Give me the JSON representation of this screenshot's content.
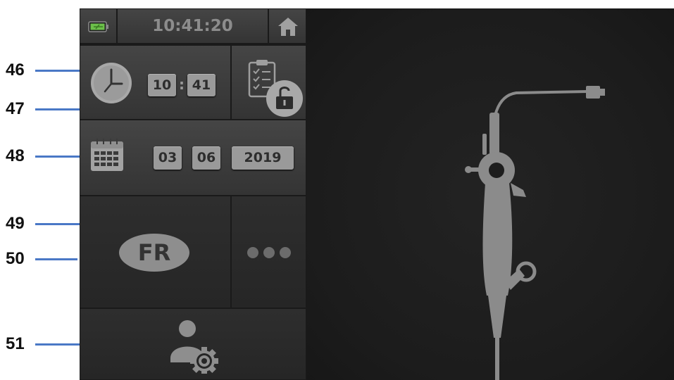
{
  "status_bar": {
    "time": "10:41:20",
    "battery_icon": "battery-icon",
    "home_icon": "home-icon"
  },
  "time_setting": {
    "hour": "10",
    "separator": ":",
    "minute": "41"
  },
  "date_setting": {
    "day": "03",
    "month": "06",
    "year": "2019"
  },
  "language": {
    "code": "FR"
  },
  "callouts": [
    {
      "label": "46"
    },
    {
      "label": "47"
    },
    {
      "label": "48"
    },
    {
      "label": "49"
    },
    {
      "label": "50"
    },
    {
      "label": "51"
    }
  ],
  "colors": {
    "callout_line": "#4a78c6",
    "battery_green": "#6cc04a",
    "chip_bg": "#9a9a9a",
    "icon_gray": "#a8a8a8"
  }
}
